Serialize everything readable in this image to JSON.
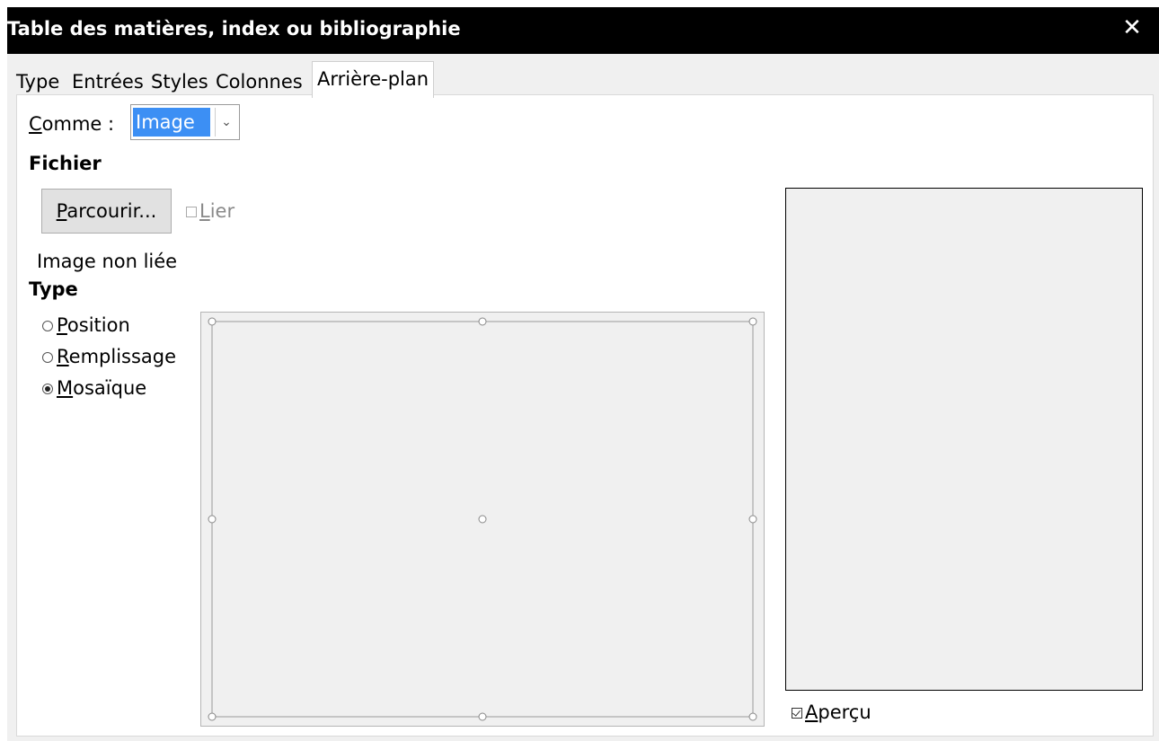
{
  "window": {
    "title": "Table des matières, index ou bibliographie",
    "close_symbol": "✕"
  },
  "tabs": [
    {
      "label": "Type",
      "active": false
    },
    {
      "label": "Entrées",
      "active": false
    },
    {
      "label": "Styles",
      "active": false
    },
    {
      "label": "Colonnes",
      "active": false
    },
    {
      "label": "Arrière-plan",
      "active": true
    }
  ],
  "background": {
    "as_label_first": "C",
    "as_label_rest": "omme :",
    "as_value": "Image",
    "file_heading": "Fichier",
    "browse_first": "P",
    "browse_rest": "arcourir...",
    "link_first": "L",
    "link_rest": "ier",
    "link_checked": false,
    "link_status": "Image non liée",
    "type_heading": "Type",
    "type_options": [
      {
        "first": "P",
        "rest": "osition",
        "selected": false
      },
      {
        "first": "R",
        "rest": "emplissage",
        "selected": false
      },
      {
        "first": "M",
        "rest": "osaïque",
        "selected": true
      }
    ],
    "preview_first": "A",
    "preview_rest": "perçu",
    "preview_checked": true
  },
  "colors": {
    "titlebar": "#000000",
    "selection": "#3c8ff4"
  }
}
